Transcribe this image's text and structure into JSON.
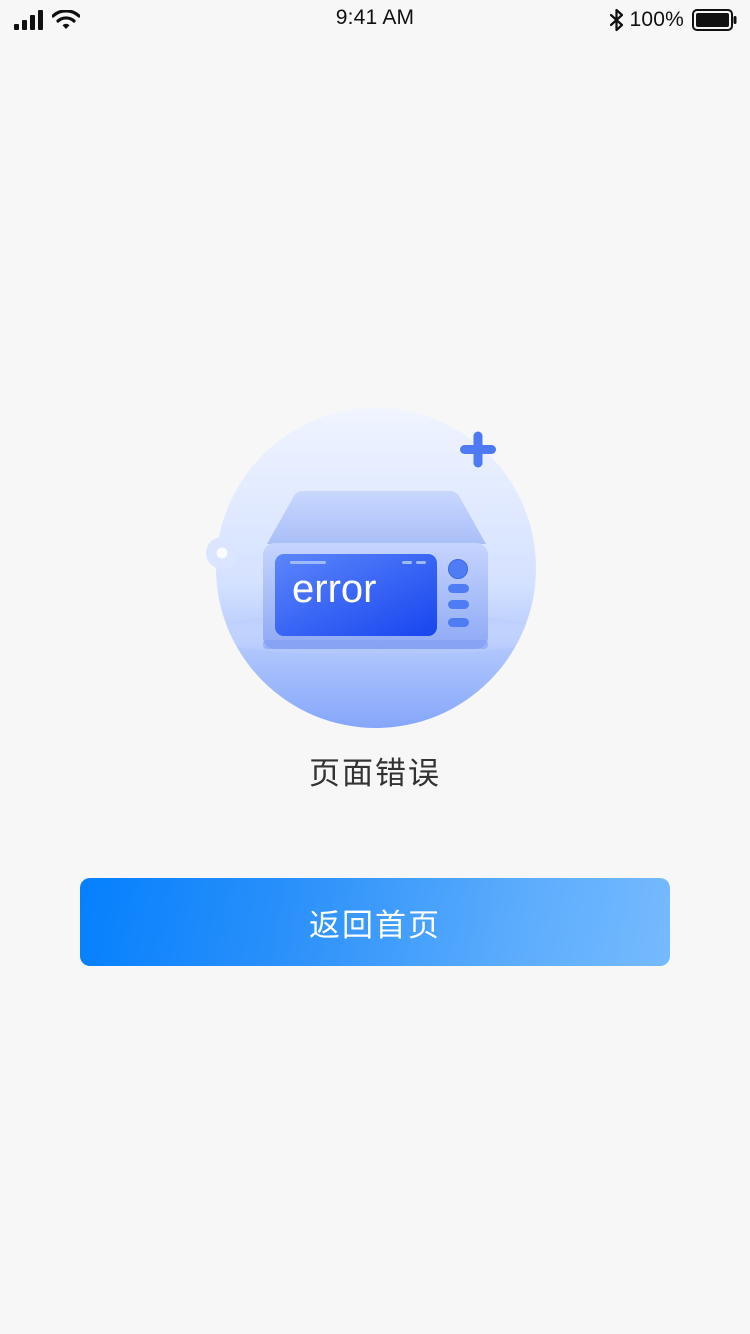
{
  "status_bar": {
    "time": "9:41 AM",
    "battery": "100%",
    "icons": [
      "signal-icon",
      "wifi-icon",
      "bluetooth-icon",
      "battery-icon"
    ]
  },
  "illustration": {
    "screen_text": "error",
    "icon": "error-device-illustration"
  },
  "error": {
    "message": "页面错误"
  },
  "actions": {
    "home_label": "返回首页"
  },
  "colors": {
    "background": "#f7f7f7",
    "button_gradient_start": "#0580fd",
    "button_gradient_end": "#76bafe",
    "message_text": "#333333",
    "illustration_blue": "#2f63f5"
  }
}
